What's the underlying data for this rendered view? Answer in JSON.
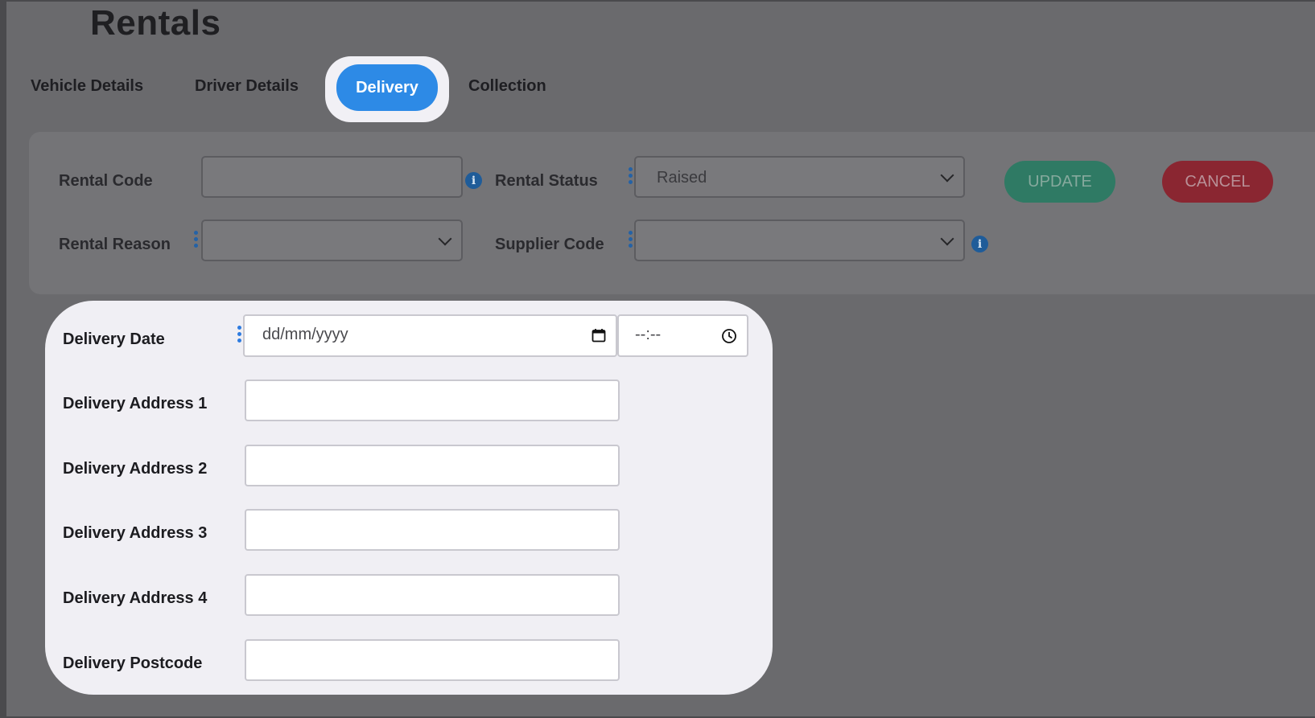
{
  "page": {
    "title": "Rentals"
  },
  "tabs": [
    {
      "label": "Vehicle Details",
      "active": false
    },
    {
      "label": "Driver Details",
      "active": false
    },
    {
      "label": "Delivery",
      "active": true
    },
    {
      "label": "Collection",
      "active": false
    }
  ],
  "header_form": {
    "rental_code": {
      "label": "Rental Code",
      "value": ""
    },
    "rental_status": {
      "label": "Rental Status",
      "value": "Raised"
    },
    "rental_reason": {
      "label": "Rental Reason",
      "value": ""
    },
    "supplier_code": {
      "label": "Supplier Code",
      "value": ""
    },
    "update_label": "UPDATE",
    "cancel_label": "CANCEL"
  },
  "delivery": {
    "date": {
      "label": "Delivery Date",
      "date_placeholder": "dd/mm/yyyy",
      "time_placeholder": "--:--"
    },
    "address1": {
      "label": "Delivery Address 1",
      "value": ""
    },
    "address2": {
      "label": "Delivery Address 2",
      "value": ""
    },
    "address3": {
      "label": "Delivery Address 3",
      "value": ""
    },
    "address4": {
      "label": "Delivery Address 4",
      "value": ""
    },
    "postcode": {
      "label": "Delivery Postcode",
      "value": ""
    }
  },
  "icons": {
    "info": "info-icon",
    "calendar": "calendar-icon",
    "clock": "clock-icon",
    "more": "kebab-icon"
  },
  "colors": {
    "active_tab": "#2d8ae6",
    "update_button": "#2f7a64",
    "cancel_button": "#8a2631",
    "overlay": "#6a6a6d",
    "highlight_card": "#f0eff4"
  }
}
